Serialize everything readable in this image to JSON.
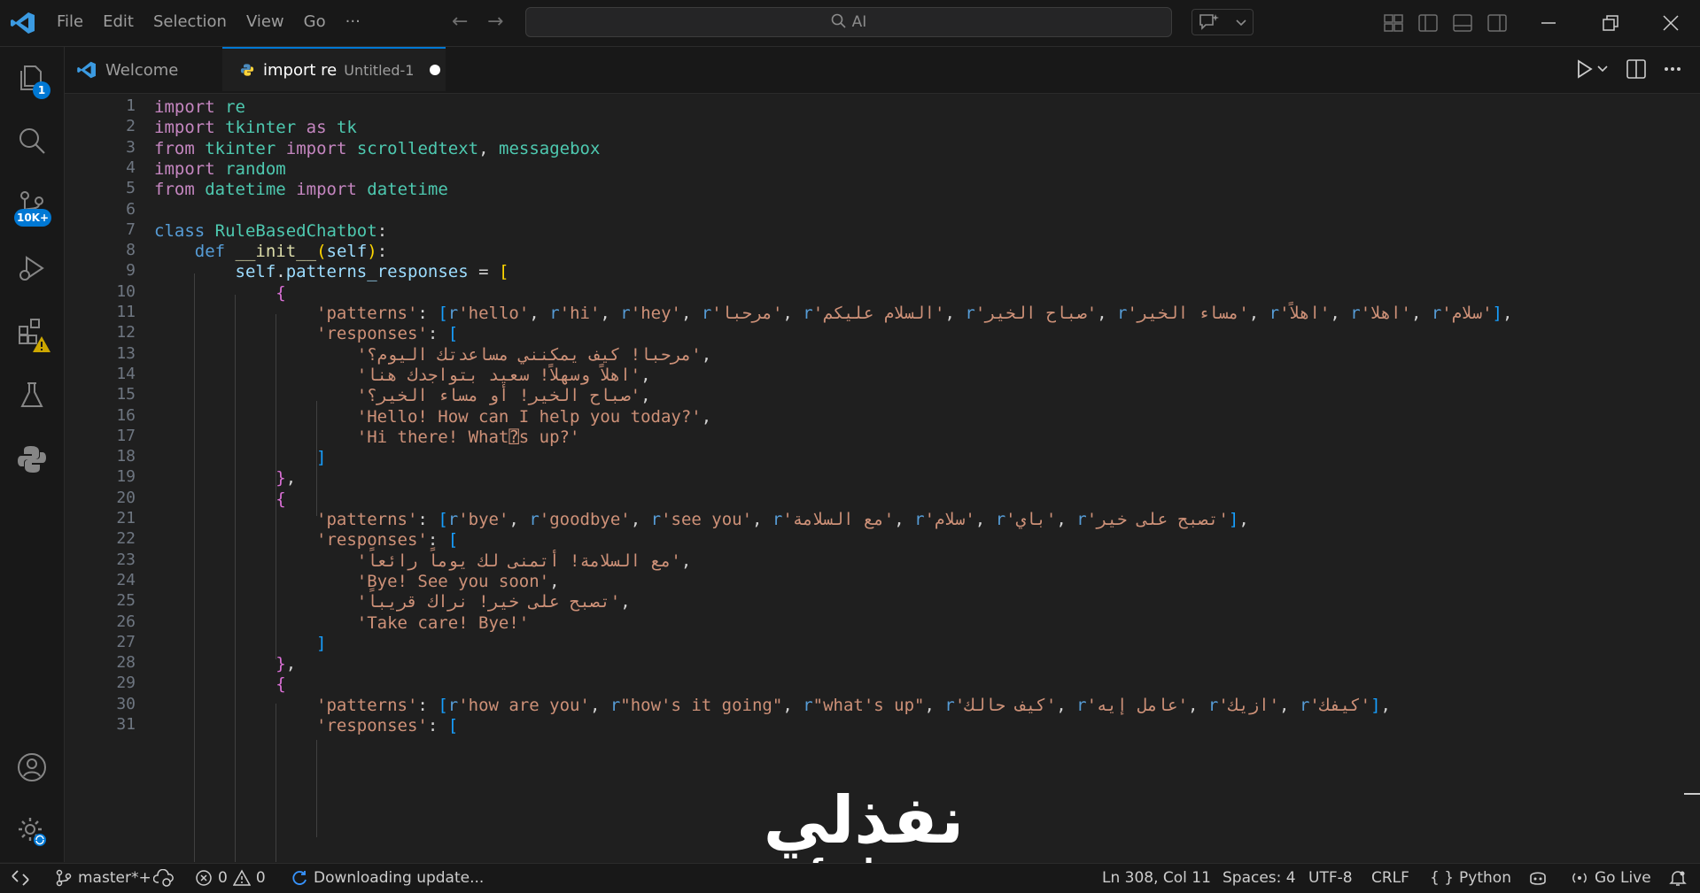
{
  "menu": [
    "File",
    "Edit",
    "Selection",
    "View",
    "Go",
    "···"
  ],
  "search": {
    "text": "AI"
  },
  "activity_badges": {
    "explorer": "1",
    "scm": "10K+"
  },
  "tabs": [
    {
      "label": "Welcome",
      "desc": ""
    },
    {
      "label": "import re",
      "desc": "Untitled-1"
    }
  ],
  "editor": {
    "line_numbers": [
      "1",
      "2",
      "3",
      "4",
      "5",
      "6",
      "7",
      "8",
      "9",
      "10",
      "11",
      "12",
      "13",
      "14",
      "15",
      "16",
      "17",
      "18",
      "19",
      "20",
      "21",
      "22",
      "23",
      "24",
      "25",
      "26",
      "27",
      "28",
      "29",
      "30",
      "31"
    ],
    "lines": [
      [
        [
          "imp",
          "import"
        ],
        [
          "pun",
          " "
        ],
        [
          "id",
          "re"
        ]
      ],
      [
        [
          "imp",
          "import"
        ],
        [
          "pun",
          " "
        ],
        [
          "id",
          "tkinter"
        ],
        [
          "pun",
          " "
        ],
        [
          "imp",
          "as"
        ],
        [
          "pun",
          " "
        ],
        [
          "id",
          "tk"
        ]
      ],
      [
        [
          "imp",
          "from"
        ],
        [
          "pun",
          " "
        ],
        [
          "id",
          "tkinter"
        ],
        [
          "pun",
          " "
        ],
        [
          "imp",
          "import"
        ],
        [
          "pun",
          " "
        ],
        [
          "id",
          "scrolledtext"
        ],
        [
          "pun",
          ", "
        ],
        [
          "id",
          "messagebox"
        ]
      ],
      [
        [
          "imp",
          "import"
        ],
        [
          "pun",
          " "
        ],
        [
          "id",
          "random"
        ]
      ],
      [
        [
          "imp",
          "from"
        ],
        [
          "pun",
          " "
        ],
        [
          "id",
          "datetime"
        ],
        [
          "pun",
          " "
        ],
        [
          "imp",
          "import"
        ],
        [
          "pun",
          " "
        ],
        [
          "id",
          "datetime"
        ]
      ],
      [],
      [
        [
          "kw",
          "class"
        ],
        [
          "pun",
          " "
        ],
        [
          "cls",
          "RuleBasedChatbot"
        ],
        [
          "pun",
          ":"
        ]
      ],
      [
        [
          "pun",
          "    "
        ],
        [
          "kw",
          "def"
        ],
        [
          "pun",
          " "
        ],
        [
          "fn",
          "__init__"
        ],
        [
          "br1",
          "("
        ],
        [
          "var",
          "self"
        ],
        [
          "br1",
          ")"
        ],
        [
          "pun",
          ":"
        ]
      ],
      [
        [
          "pun",
          "        "
        ],
        [
          "var",
          "self"
        ],
        [
          "pun",
          "."
        ],
        [
          "var",
          "patterns_responses"
        ],
        [
          "pun",
          " = "
        ],
        [
          "br1",
          "["
        ]
      ],
      [
        [
          "pun",
          "            "
        ],
        [
          "br2",
          "{"
        ]
      ],
      [
        [
          "pun",
          "                "
        ],
        [
          "str",
          "'patterns'"
        ],
        [
          "pun",
          ": "
        ],
        [
          "br3",
          "["
        ],
        [
          "pfx",
          "r"
        ],
        [
          "str",
          "'hello'"
        ],
        [
          "pun",
          ", "
        ],
        [
          "pfx",
          "r"
        ],
        [
          "str",
          "'hi'"
        ],
        [
          "pun",
          ", "
        ],
        [
          "pfx",
          "r"
        ],
        [
          "str",
          "'hey'"
        ],
        [
          "pun",
          ", "
        ],
        [
          "pfx",
          "r"
        ],
        [
          "str",
          "'مرحبا'"
        ],
        [
          "pun",
          ", "
        ],
        [
          "pfx",
          "r"
        ],
        [
          "str",
          "'السلام عليكم'"
        ],
        [
          "pun",
          ", "
        ],
        [
          "pfx",
          "r"
        ],
        [
          "str",
          "'صباح الخير'"
        ],
        [
          "pun",
          ", "
        ],
        [
          "pfx",
          "r"
        ],
        [
          "str",
          "'مساء الخير'"
        ],
        [
          "pun",
          ", "
        ],
        [
          "pfx",
          "r"
        ],
        [
          "str",
          "'اهلاً'"
        ],
        [
          "pun",
          ", "
        ],
        [
          "pfx",
          "r"
        ],
        [
          "str",
          "'اهلا'"
        ],
        [
          "pun",
          ", "
        ],
        [
          "pfx",
          "r"
        ],
        [
          "str",
          "'سلام'"
        ],
        [
          "br3",
          "]"
        ],
        [
          "pun",
          ","
        ]
      ],
      [
        [
          "pun",
          "                "
        ],
        [
          "str",
          "'responses'"
        ],
        [
          "pun",
          ": "
        ],
        [
          "br3",
          "["
        ]
      ],
      [
        [
          "pun",
          "                    "
        ],
        [
          "str",
          "'مرحبا! كيف يمكنني مساعدتك اليوم؟'"
        ],
        [
          "pun",
          ","
        ]
      ],
      [
        [
          "pun",
          "                    "
        ],
        [
          "str",
          "'اهلاً وسهلاً! سعيد بتواجدك هنا'"
        ],
        [
          "pun",
          ","
        ]
      ],
      [
        [
          "pun",
          "                    "
        ],
        [
          "str",
          "'صباح الخير! أو مساء الخير؟'"
        ],
        [
          "pun",
          ","
        ]
      ],
      [
        [
          "pun",
          "                    "
        ],
        [
          "str",
          "'Hello! How can I help you today?'"
        ],
        [
          "pun",
          ","
        ]
      ],
      [
        [
          "pun",
          "                    "
        ],
        [
          "str",
          "'Hi there! What⍰s up?'"
        ]
      ],
      [
        [
          "pun",
          "                "
        ],
        [
          "br3",
          "]"
        ]
      ],
      [
        [
          "pun",
          "            "
        ],
        [
          "br2",
          "}"
        ],
        [
          "pun",
          ","
        ]
      ],
      [
        [
          "pun",
          "            "
        ],
        [
          "br2",
          "{"
        ]
      ],
      [
        [
          "pun",
          "                "
        ],
        [
          "str",
          "'patterns'"
        ],
        [
          "pun",
          ": "
        ],
        [
          "br3",
          "["
        ],
        [
          "pfx",
          "r"
        ],
        [
          "str",
          "'bye'"
        ],
        [
          "pun",
          ", "
        ],
        [
          "pfx",
          "r"
        ],
        [
          "str",
          "'goodbye'"
        ],
        [
          "pun",
          ", "
        ],
        [
          "pfx",
          "r"
        ],
        [
          "str",
          "'see you'"
        ],
        [
          "pun",
          ", "
        ],
        [
          "pfx",
          "r"
        ],
        [
          "str",
          "'مع السلامة'"
        ],
        [
          "pun",
          ", "
        ],
        [
          "pfx",
          "r"
        ],
        [
          "str",
          "'سلام'"
        ],
        [
          "pun",
          ", "
        ],
        [
          "pfx",
          "r"
        ],
        [
          "str",
          "'باي'"
        ],
        [
          "pun",
          ", "
        ],
        [
          "pfx",
          "r"
        ],
        [
          "str",
          "'تصبح على خير'"
        ],
        [
          "br3",
          "]"
        ],
        [
          "pun",
          ","
        ]
      ],
      [
        [
          "pun",
          "                "
        ],
        [
          "str",
          "'responses'"
        ],
        [
          "pun",
          ": "
        ],
        [
          "br3",
          "["
        ]
      ],
      [
        [
          "pun",
          "                    "
        ],
        [
          "str",
          "'مع السلامة! أتمنى لك يوماً رائعاً'"
        ],
        [
          "pun",
          ","
        ]
      ],
      [
        [
          "pun",
          "                    "
        ],
        [
          "str",
          "'Bye! See you soon'"
        ],
        [
          "pun",
          ","
        ]
      ],
      [
        [
          "pun",
          "                    "
        ],
        [
          "str",
          "'تصبح على خير! نراك قريباً'"
        ],
        [
          "pun",
          ","
        ]
      ],
      [
        [
          "pun",
          "                    "
        ],
        [
          "str",
          "'Take care! Bye!'"
        ]
      ],
      [
        [
          "pun",
          "                "
        ],
        [
          "br3",
          "]"
        ]
      ],
      [
        [
          "pun",
          "            "
        ],
        [
          "br2",
          "}"
        ],
        [
          "pun",
          ","
        ]
      ],
      [
        [
          "pun",
          "            "
        ],
        [
          "br2",
          "{"
        ]
      ],
      [
        [
          "pun",
          "                "
        ],
        [
          "str",
          "'patterns'"
        ],
        [
          "pun",
          ": "
        ],
        [
          "br3",
          "["
        ],
        [
          "pfx",
          "r"
        ],
        [
          "str",
          "'how are you'"
        ],
        [
          "pun",
          ", "
        ],
        [
          "pfx",
          "r"
        ],
        [
          "str",
          "\"how's it going\""
        ],
        [
          "pun",
          ", "
        ],
        [
          "pfx",
          "r"
        ],
        [
          "str",
          "\"what's up\""
        ],
        [
          "pun",
          ", "
        ],
        [
          "pfx",
          "r"
        ],
        [
          "str",
          "'كيف حالك'"
        ],
        [
          "pun",
          ", "
        ],
        [
          "pfx",
          "r"
        ],
        [
          "str",
          "'عامل إيه'"
        ],
        [
          "pun",
          ", "
        ],
        [
          "pfx",
          "r"
        ],
        [
          "str",
          "'ازيك'"
        ],
        [
          "pun",
          ", "
        ],
        [
          "pfx",
          "r"
        ],
        [
          "str",
          "'كيفك'"
        ],
        [
          "br3",
          "]"
        ],
        [
          "pun",
          ","
        ]
      ],
      [
        [
          "pun",
          "                "
        ],
        [
          "str",
          "'responses'"
        ],
        [
          "pun",
          ": "
        ],
        [
          "br3",
          "["
        ]
      ]
    ]
  },
  "status": {
    "branch": "master*+",
    "errors": "0",
    "warnings": "0",
    "update": "Downloading update...",
    "position": "Ln 308, Col 11",
    "spaces": "Spaces: 4",
    "encoding": "UTF-8",
    "eol": "CRLF",
    "language": "Python",
    "golive": "Go Live"
  },
  "watermark": {
    "arabic": "نفذلي",
    "latin": "nafezly.com"
  }
}
